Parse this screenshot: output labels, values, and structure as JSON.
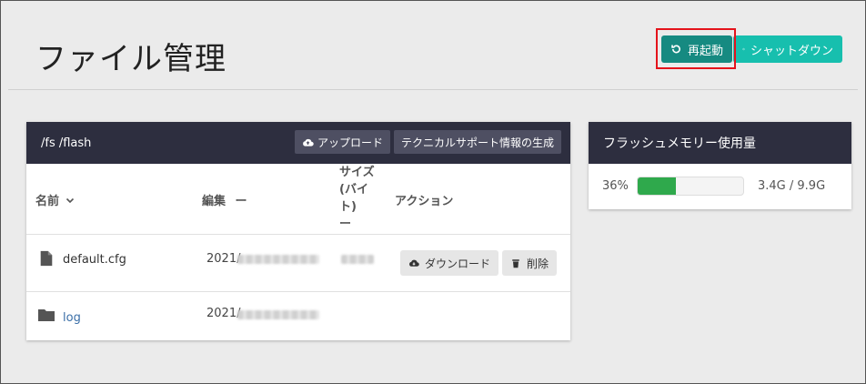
{
  "header": {
    "title": "ファイル管理",
    "restart_label": "再起動",
    "shutdown_label": "シャットダウン"
  },
  "file_panel": {
    "path": "/fs /flash",
    "upload_label": "アップロード",
    "support_label": "テクニカルサポート情報の生成",
    "columns": {
      "name": "名前",
      "edited": "編集",
      "size_line1": "サイズ",
      "size_line2": "(バイ",
      "size_line3": "ト)",
      "size_sort": "ー",
      "actions": "アクション",
      "edited_sort": "ー"
    },
    "rows": [
      {
        "name": "default.cfg",
        "type": "file",
        "date_prefix": "2021/",
        "download_label": "ダウンロード",
        "delete_label": "削除"
      },
      {
        "name": "log",
        "type": "folder",
        "date_prefix": "2021/"
      }
    ]
  },
  "flash_panel": {
    "title": "フラッシュメモリー使用量",
    "percent_label": "36%",
    "percent_value": 36,
    "usage_label": "3.4G / 9.9G",
    "bar_color": "#2fa94c"
  }
}
